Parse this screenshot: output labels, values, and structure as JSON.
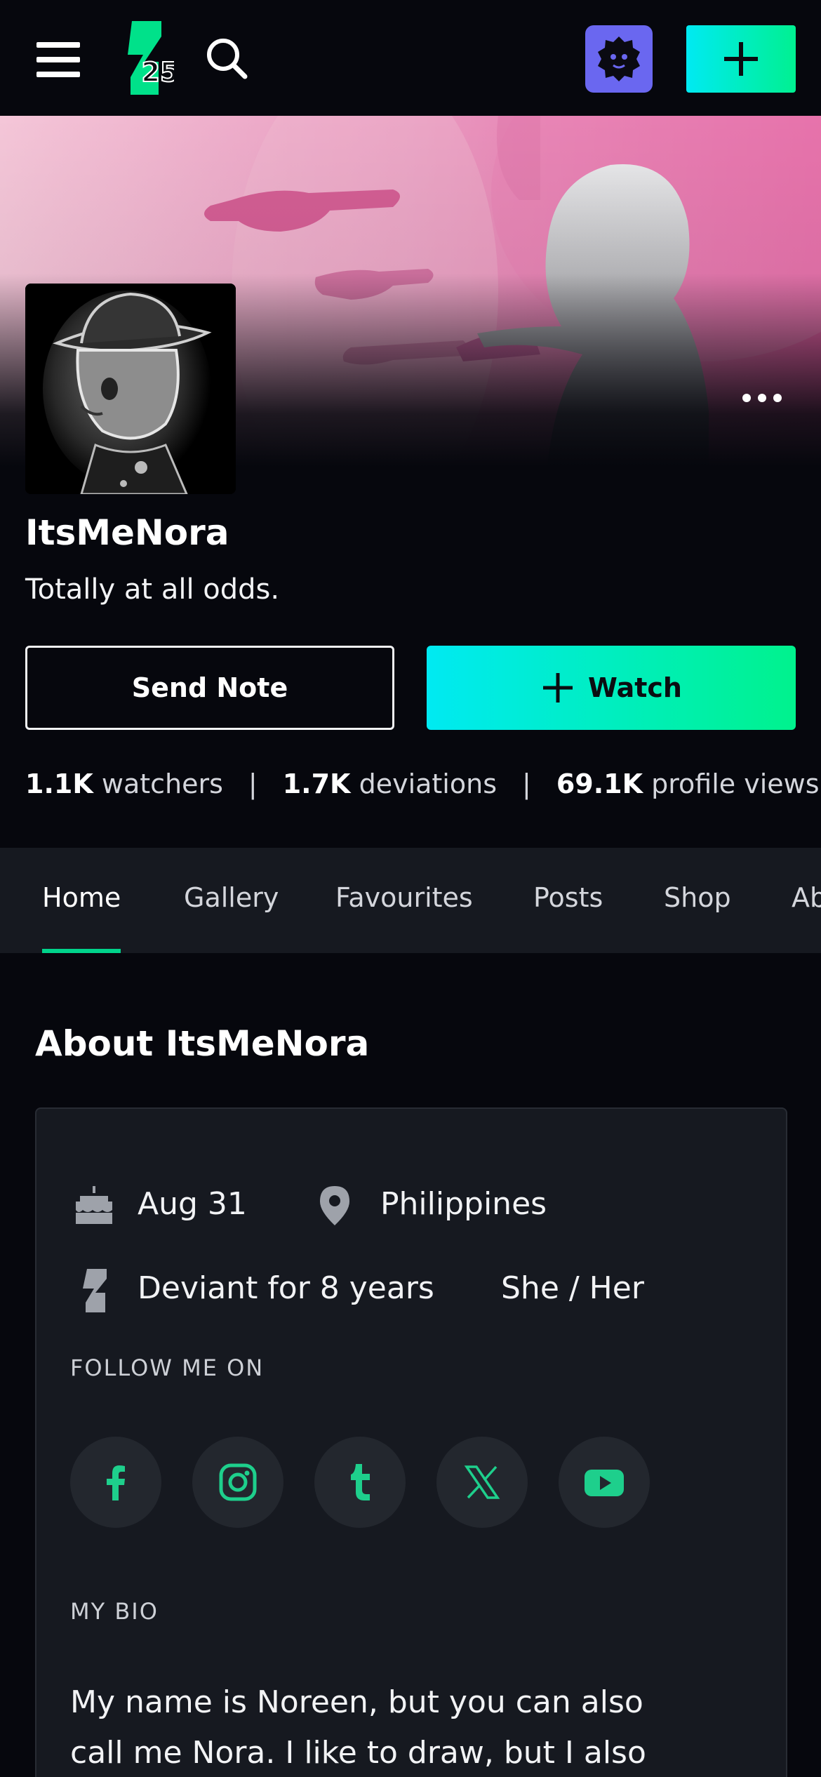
{
  "header": {
    "menu_icon": "hamburger-icon",
    "logo_badge": "25",
    "search_icon": "search-icon",
    "avatar_icon": "gear-avatar-icon",
    "create_icon": "plus-icon"
  },
  "profile": {
    "username": "ItsMeNora",
    "tagline": "Totally at all odds.",
    "send_note_label": "Send Note",
    "watch_label": "Watch",
    "stats": {
      "watchers_count": "1.1K",
      "watchers_label": "watchers",
      "deviations_count": "1.7K",
      "deviations_label": "deviations",
      "views_count": "69.1K",
      "views_label": "profile views",
      "separator": "|"
    }
  },
  "tabs": [
    {
      "label": "Home",
      "active": true
    },
    {
      "label": "Gallery"
    },
    {
      "label": "Favourites"
    },
    {
      "label": "Posts"
    },
    {
      "label": "Shop"
    },
    {
      "label": "About"
    }
  ],
  "about": {
    "title": "About ItsMeNora",
    "birthday": "Aug 31",
    "location": "Philippines",
    "deviant_for": "Deviant for 8 years",
    "pronouns": "She / Her",
    "follow_label": "FOLLOW ME ON",
    "socials": [
      "facebook",
      "instagram",
      "tumblr",
      "x",
      "youtube"
    ],
    "bio_label": "MY BIO",
    "bio_text": "My name is Noreen, but you can also call me Nora. I like to draw, but I also"
  },
  "colors": {
    "accent_green": "#00d38b",
    "gradient_start": "#00eaf2",
    "gradient_end": "#00f28d",
    "avatar_bg": "#6a67f0"
  }
}
